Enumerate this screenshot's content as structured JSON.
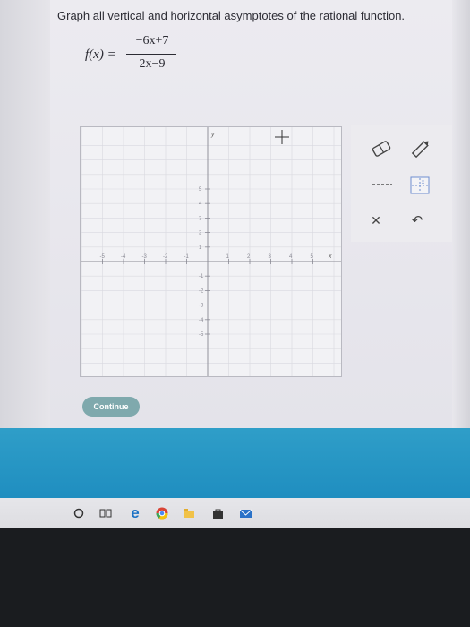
{
  "question": {
    "prompt": "Graph all vertical and horizontal asymptotes of the rational function.",
    "function_label": "f(x) =",
    "numerator": "−6x+7",
    "denominator": "2x−9"
  },
  "graph": {
    "y_axis_label": "y",
    "x_axis_label": "x",
    "x_tick_labels": [
      "-5",
      "-4",
      "-3",
      "-2",
      "-1",
      "1",
      "2",
      "3",
      "4",
      "5"
    ],
    "y_tick_labels": [
      "5",
      "4",
      "3",
      "2",
      "1",
      "-1",
      "-2",
      "-3",
      "-4",
      "-5"
    ],
    "x_range": [
      -5,
      5
    ],
    "y_range": [
      -5,
      5
    ]
  },
  "tools": {
    "eraser_icon": "eraser-icon",
    "pencil_icon": "pencil-icon",
    "dashed_line_icon": "dashed-line-icon",
    "asymptote_icon": "asymptote-icon",
    "clear_symbol": "✕",
    "undo_symbol": "↶",
    "help_symbol": "?"
  },
  "buttons": {
    "continue_label": "Continue"
  },
  "colors": {
    "continue_bg": "#7fa9ad",
    "banner_blue": "#1f8ec0",
    "help_orange": "#e0902a"
  }
}
